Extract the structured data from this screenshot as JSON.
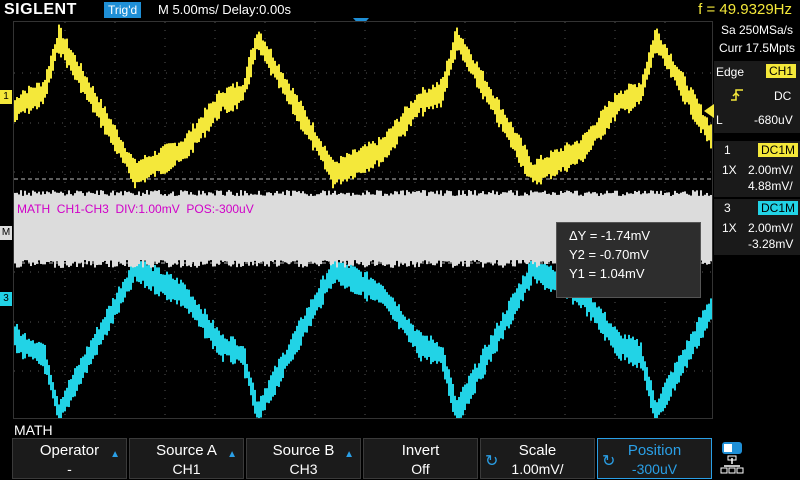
{
  "header": {
    "brand": "SIGLENT",
    "trigger_status": "Trig'd",
    "timebase": "M 5.00ms/ Delay:0.00s",
    "frequency": "f = 49.9329Hz"
  },
  "acquisition": {
    "sample_rate": "Sa 250MSa/s",
    "memory": "Curr 17.5Mpts"
  },
  "trigger": {
    "type": "Edge",
    "source": "CH1",
    "slope_icon": "rising-edge-icon",
    "coupling": "DC",
    "level_label": "L",
    "level": "-680uV"
  },
  "channels": [
    {
      "number": "1",
      "coupling_badge": "DC1M",
      "probe": "1X",
      "scale": "2.00mV/",
      "offset": "4.88mV/",
      "color": "#f4e83a"
    },
    {
      "number": "3",
      "coupling_badge": "DC1M",
      "probe": "1X",
      "scale": "2.00mV/",
      "offset": "-3.28mV",
      "color": "#22d3e6"
    }
  ],
  "math_overlay": {
    "text": "MATH  CH1-CH3  DIV:1.00mV  POS:-300uV",
    "color": "#d000c8"
  },
  "cursor_readout": {
    "delta_y": "ΔY = -1.74mV",
    "y2": "Y2 = -0.70mV",
    "y1": "Y1 = 1.04mV"
  },
  "menu_title": "MATH",
  "softkeys": [
    {
      "label": "Operator",
      "value": "-",
      "arrow": true,
      "knob": false,
      "active": false
    },
    {
      "label": "Source A",
      "value": "CH1",
      "arrow": true,
      "knob": false,
      "active": false
    },
    {
      "label": "Source B",
      "value": "CH3",
      "arrow": true,
      "knob": false,
      "active": false
    },
    {
      "label": "Invert",
      "value": "Off",
      "arrow": false,
      "knob": false,
      "active": false
    },
    {
      "label": "Scale",
      "value": "1.00mV/",
      "arrow": false,
      "knob": true,
      "active": false
    },
    {
      "label": "Position",
      "value": "-300uV",
      "arrow": false,
      "knob": true,
      "active": true
    }
  ],
  "colors": {
    "ch1": "#f4e83a",
    "ch3": "#22d3e6",
    "math": "#dcdcdc",
    "accent": "#1f8fd6"
  }
}
